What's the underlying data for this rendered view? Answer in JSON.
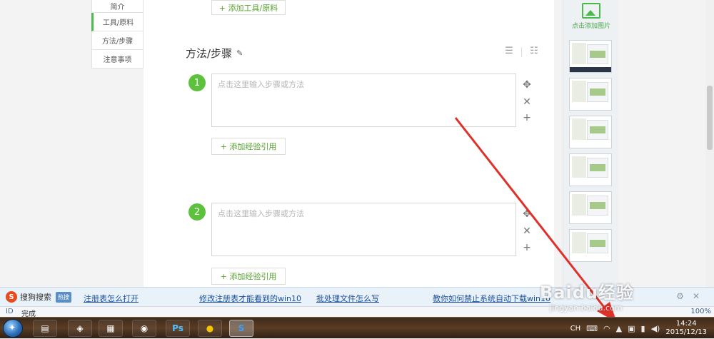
{
  "left_nav": {
    "items": [
      {
        "label": "简介"
      },
      {
        "label": "工具/原料"
      },
      {
        "label": "方法/步骤"
      },
      {
        "label": "注意事项"
      }
    ]
  },
  "editor": {
    "add_tool_button": "+ 添加工具/原料",
    "section_title": "方法/步骤",
    "steps": [
      {
        "number": "1",
        "placeholder": "点击这里输入步骤或方法",
        "add_ref_button": "+ 添加经验引用"
      },
      {
        "number": "2",
        "placeholder": "点击这里输入步骤或方法",
        "add_ref_button": "+ 添加经验引用"
      }
    ]
  },
  "right_panel": {
    "add_image_label": "点击添加图片",
    "thumbnail_count": 6
  },
  "search_bar": {
    "brand": "S",
    "name": "搜狗搜索",
    "hot_badge": "热搜",
    "hot_links": [
      "注册表怎么打开",
      "修改注册表才能看到的win10",
      "批处理文件怎么写",
      "教你如何禁止系统自动下载win10"
    ]
  },
  "status_bar": {
    "id": "ID",
    "status": "完成",
    "zoom": "100%"
  },
  "watermark": {
    "top": "Baidu经验",
    "bottom": "jingyan.baidu.com"
  },
  "taskbar": {
    "apps": [
      {
        "name": "file-explorer",
        "glyph": "▤"
      },
      {
        "name": "app-icon",
        "glyph": "◈"
      },
      {
        "name": "media-icon",
        "glyph": "▦"
      },
      {
        "name": "network-icon",
        "glyph": "◉"
      },
      {
        "name": "photoshop",
        "glyph": "Ps"
      },
      {
        "name": "game-app",
        "glyph": "●"
      },
      {
        "name": "sogou-browser",
        "glyph": "S"
      }
    ],
    "tray": {
      "lang": "CH",
      "time": "14:24",
      "date": "2015/12/13"
    }
  },
  "colors": {
    "accent_green": "#5cc13c",
    "link_blue": "#1a4e9a",
    "arrow_red": "#e0302a"
  }
}
